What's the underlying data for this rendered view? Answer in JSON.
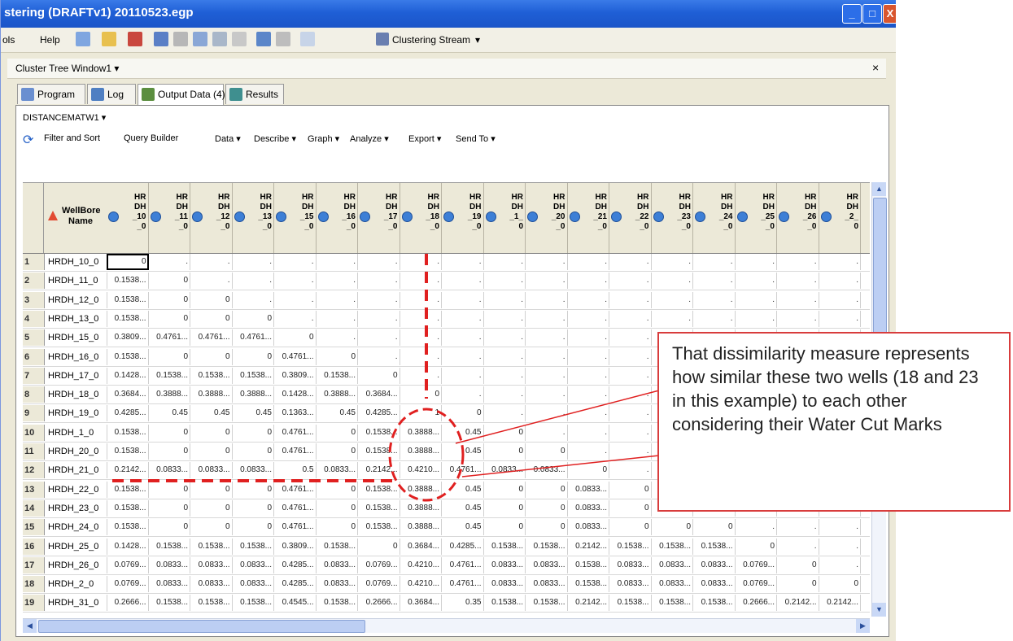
{
  "window": {
    "title": "stering (DRAFTv1) 20110523.egp",
    "controls": {
      "minimize": "_",
      "maximize": "□",
      "close": "X"
    }
  },
  "menu": {
    "items": [
      "ols",
      "Help"
    ],
    "toolbar_icons": [
      "new-icon",
      "open-icon",
      "import-icon",
      "save-icon",
      "cut-icon",
      "copy-icon",
      "paste-icon",
      "delete-icon",
      "undo-icon",
      "redo-icon",
      "view-icon"
    ],
    "stream_label": "Clustering Stream",
    "stream_arrow": "▾"
  },
  "panel": {
    "title": "Cluster Tree Window1 ▾",
    "close": "×"
  },
  "tabs": [
    {
      "label": "Program",
      "icon": "program-icon",
      "color": "#6a8fd0"
    },
    {
      "label": "Log",
      "icon": "log-icon",
      "color": "#4f7fc2"
    },
    {
      "label": "Output Data (4)",
      "icon": "output-data-icon",
      "color": "#5b8e3f"
    },
    {
      "label": "Results",
      "icon": "results-icon",
      "color": "#3f8f8f"
    }
  ],
  "dataset": {
    "label": "DISTANCEMATW1 ▾"
  },
  "toolbar": {
    "refresh_icon": "⟳",
    "items": [
      "Filter and Sort",
      "Query Builder",
      "Data ▾",
      "Describe ▾",
      "Graph ▾",
      "Analyze ▾",
      "Export ▾",
      "Send To ▾"
    ]
  },
  "table": {
    "name_header": "WellBore\nName",
    "columns": [
      "HR\nDH\n_10\n_0",
      "HR\nDH\n_11\n_0",
      "HR\nDH\n_12\n_0",
      "HR\nDH\n_13\n_0",
      "HR\nDH\n_15\n_0",
      "HR\nDH\n_16\n_0",
      "HR\nDH\n_17\n_0",
      "HR\nDH\n_18\n_0",
      "HR\nDH\n_19\n_0",
      "HR\nDH\n_1_\n0",
      "HR\nDH\n_20\n_0",
      "HR\nDH\n_21\n_0",
      "HR\nDH\n_22\n_0",
      "HR\nDH\n_23\n_0",
      "HR\nDH\n_24\n_0",
      "HR\nDH\n_25\n_0",
      "HR\nDH\n_26\n_0",
      "HR\nDH\n_2_\n0"
    ],
    "rows": [
      {
        "n": "1",
        "name": "HRDH_10_0",
        "cells": [
          "0",
          ".",
          ".",
          ".",
          ".",
          ".",
          ".",
          ".",
          ".",
          ".",
          ".",
          ".",
          ".",
          ".",
          ".",
          ".",
          ".",
          "."
        ]
      },
      {
        "n": "2",
        "name": "HRDH_11_0",
        "cells": [
          "0.1538...",
          "0",
          ".",
          ".",
          ".",
          ".",
          ".",
          ".",
          ".",
          ".",
          ".",
          ".",
          ".",
          ".",
          ".",
          ".",
          ".",
          "."
        ]
      },
      {
        "n": "3",
        "name": "HRDH_12_0",
        "cells": [
          "0.1538...",
          "0",
          "0",
          ".",
          ".",
          ".",
          ".",
          ".",
          ".",
          ".",
          ".",
          ".",
          ".",
          ".",
          ".",
          ".",
          ".",
          "."
        ]
      },
      {
        "n": "4",
        "name": "HRDH_13_0",
        "cells": [
          "0.1538...",
          "0",
          "0",
          "0",
          ".",
          ".",
          ".",
          ".",
          ".",
          ".",
          ".",
          ".",
          ".",
          ".",
          ".",
          ".",
          ".",
          "."
        ]
      },
      {
        "n": "5",
        "name": "HRDH_15_0",
        "cells": [
          "0.3809...",
          "0.4761...",
          "0.4761...",
          "0.4761...",
          "0",
          ".",
          ".",
          ".",
          ".",
          ".",
          ".",
          ".",
          ".",
          ".",
          ".",
          ".",
          ".",
          "."
        ]
      },
      {
        "n": "6",
        "name": "HRDH_16_0",
        "cells": [
          "0.1538...",
          "0",
          "0",
          "0",
          "0.4761...",
          "0",
          ".",
          ".",
          ".",
          ".",
          ".",
          ".",
          ".",
          ".",
          ".",
          ".",
          ".",
          "."
        ]
      },
      {
        "n": "7",
        "name": "HRDH_17_0",
        "cells": [
          "0.1428...",
          "0.1538...",
          "0.1538...",
          "0.1538...",
          "0.3809...",
          "0.1538...",
          "0",
          ".",
          ".",
          ".",
          ".",
          ".",
          ".",
          ".",
          ".",
          ".",
          ".",
          "."
        ]
      },
      {
        "n": "8",
        "name": "HRDH_18_0",
        "cells": [
          "0.3684...",
          "0.3888...",
          "0.3888...",
          "0.3888...",
          "0.1428...",
          "0.3888...",
          "0.3684...",
          "0",
          ".",
          ".",
          ".",
          ".",
          ".",
          ".",
          ".",
          ".",
          ".",
          "."
        ]
      },
      {
        "n": "9",
        "name": "HRDH_19_0",
        "cells": [
          "0.4285...",
          "0.45",
          "0.45",
          "0.45",
          "0.1363...",
          "0.45",
          "0.4285...",
          "1",
          "0",
          ".",
          ".",
          ".",
          ".",
          ".",
          ".",
          ".",
          ".",
          "."
        ]
      },
      {
        "n": "10",
        "name": "HRDH_1_0",
        "cells": [
          "0.1538...",
          "0",
          "0",
          "0",
          "0.4761...",
          "0",
          "0.1538...",
          "0.3888...",
          "0.45",
          "0",
          ".",
          ".",
          ".",
          ".",
          ".",
          ".",
          ".",
          "."
        ]
      },
      {
        "n": "11",
        "name": "HRDH_20_0",
        "cells": [
          "0.1538...",
          "0",
          "0",
          "0",
          "0.4761...",
          "0",
          "0.1538...",
          "0.3888...",
          "0.45",
          "0",
          "0",
          ".",
          ".",
          ".",
          ".",
          ".",
          ".",
          "."
        ]
      },
      {
        "n": "12",
        "name": "HRDH_21_0",
        "cells": [
          "0.2142...",
          "0.0833...",
          "0.0833...",
          "0.0833...",
          "0.5",
          "0.0833...",
          "0.2142...",
          "0.4210...",
          "0.4761...",
          "0.0833...",
          "0.0833...",
          "0",
          ".",
          ".",
          ".",
          ".",
          ".",
          "."
        ]
      },
      {
        "n": "13",
        "name": "HRDH_22_0",
        "cells": [
          "0.1538...",
          "0",
          "0",
          "0",
          "0.4761...",
          "0",
          "0.1538...",
          "0.3888...",
          "0.45",
          "0",
          "0",
          "0.0833...",
          "0",
          ".",
          ".",
          ".",
          ".",
          "."
        ]
      },
      {
        "n": "14",
        "name": "HRDH_23_0",
        "cells": [
          "0.1538...",
          "0",
          "0",
          "0",
          "0.4761...",
          "0",
          "0.1538...",
          "0.3888...",
          "0.45",
          "0",
          "0",
          "0.0833...",
          "0",
          "0",
          ".",
          ".",
          ".",
          "."
        ]
      },
      {
        "n": "15",
        "name": "HRDH_24_0",
        "cells": [
          "0.1538...",
          "0",
          "0",
          "0",
          "0.4761...",
          "0",
          "0.1538...",
          "0.3888...",
          "0.45",
          "0",
          "0",
          "0.0833...",
          "0",
          "0",
          "0",
          ".",
          ".",
          "."
        ]
      },
      {
        "n": "16",
        "name": "HRDH_25_0",
        "cells": [
          "0.1428...",
          "0.1538...",
          "0.1538...",
          "0.1538...",
          "0.3809...",
          "0.1538...",
          "0",
          "0.3684...",
          "0.4285...",
          "0.1538...",
          "0.1538...",
          "0.2142...",
          "0.1538...",
          "0.1538...",
          "0.1538...",
          "0",
          ".",
          "."
        ]
      },
      {
        "n": "17",
        "name": "HRDH_26_0",
        "cells": [
          "0.0769...",
          "0.0833...",
          "0.0833...",
          "0.0833...",
          "0.4285...",
          "0.0833...",
          "0.0769...",
          "0.4210...",
          "0.4761...",
          "0.0833...",
          "0.0833...",
          "0.1538...",
          "0.0833...",
          "0.0833...",
          "0.0833...",
          "0.0769...",
          "0",
          "."
        ]
      },
      {
        "n": "18",
        "name": "HRDH_2_0",
        "cells": [
          "0.0769...",
          "0.0833...",
          "0.0833...",
          "0.0833...",
          "0.4285...",
          "0.0833...",
          "0.0769...",
          "0.4210...",
          "0.4761...",
          "0.0833...",
          "0.0833...",
          "0.1538...",
          "0.0833...",
          "0.0833...",
          "0.0833...",
          "0.0769...",
          "0",
          "0"
        ]
      },
      {
        "n": "19",
        "name": "HRDH_31_0",
        "cells": [
          "0.2666...",
          "0.1538...",
          "0.1538...",
          "0.1538...",
          "0.4545...",
          "0.1538...",
          "0.2666...",
          "0.3684...",
          "0.35",
          "0.1538...",
          "0.1538...",
          "0.2142...",
          "0.1538...",
          "0.1538...",
          "0.1538...",
          "0.2666...",
          "0.2142...",
          "0.2142..."
        ]
      }
    ]
  },
  "annotation": {
    "callout_text": "That dissimilarity measure represents how similar these two wells (18 and 23 in this example) to each other considering their Water Cut Marks",
    "color": "#e02020"
  },
  "scroll": {
    "up": "▲",
    "down": "▼",
    "left": "◀",
    "right": "▶"
  }
}
